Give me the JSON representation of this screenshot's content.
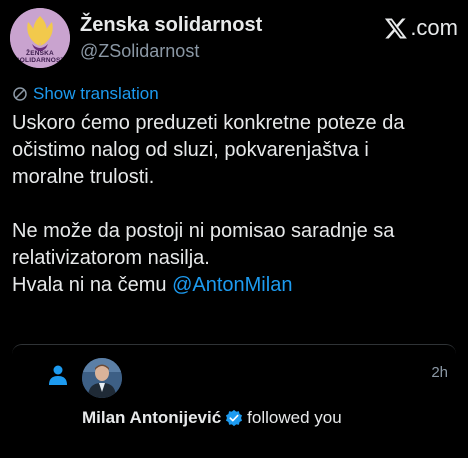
{
  "account": {
    "name": "Ženska solidarnost",
    "handle": "@ZSolidarnost",
    "logo_text": [
      "ŽENSKA",
      "SOLIDARNOST"
    ]
  },
  "site": {
    "brand": "X",
    "domain_suffix": ".com"
  },
  "translate": {
    "label": "Show translation",
    "icon": "translate-icon"
  },
  "tweet": {
    "paragraph1": [
      "Uskoro ćemo preduzeti konkretne poteze da",
      "očistimo nalog od sluzi, pokvarenjaštva i",
      "moralne trulosti."
    ],
    "paragraph2": [
      "Ne može da postoji ni pomisao saradnje sa",
      "relativizatorom nasilja."
    ],
    "closing_text": "Hvala ni na čemu ",
    "mention": "@AntonMilan"
  },
  "notification": {
    "icon": "person-icon",
    "time": "2h",
    "user_name": "Milan Antonijević",
    "verified": true,
    "action": "followed you"
  },
  "colors": {
    "background": "#000000",
    "text": "#e7e9ea",
    "secondary": "#8b98a5",
    "accent": "#1d9bf0",
    "avatar_bg": "#c9a3cf"
  }
}
